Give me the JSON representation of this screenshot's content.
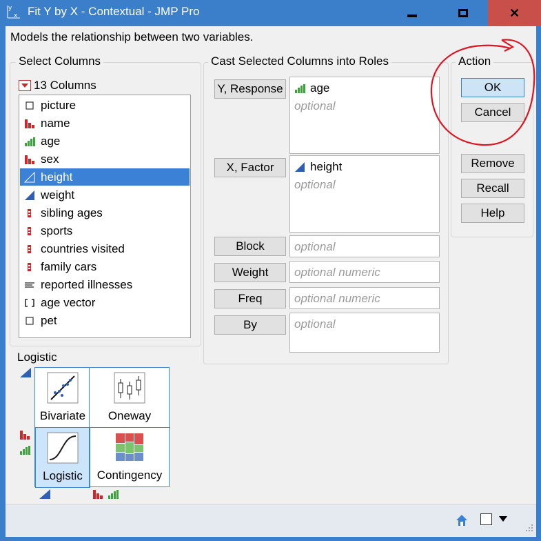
{
  "window": {
    "title": "Fit Y by X - Contextual - JMP Pro",
    "minimize": "minimize",
    "maximize": "maximize",
    "close": "close"
  },
  "description": "Models the relationship between two variables.",
  "select_columns": {
    "group_label": "Select Columns",
    "count_label": "13 Columns",
    "items": [
      {
        "label": "picture",
        "icon": "expression-icon"
      },
      {
        "label": "name",
        "icon": "nominal-icon"
      },
      {
        "label": "age",
        "icon": "ordinal-icon"
      },
      {
        "label": "sex",
        "icon": "nominal-icon"
      },
      {
        "label": "height",
        "icon": "continuous-icon",
        "selected": true
      },
      {
        "label": "weight",
        "icon": "continuous-icon"
      },
      {
        "label": "sibling ages",
        "icon": "multiple-response-icon"
      },
      {
        "label": "sports",
        "icon": "multiple-response-icon"
      },
      {
        "label": "countries visited",
        "icon": "multiple-response-icon"
      },
      {
        "label": "family cars",
        "icon": "multiple-response-icon"
      },
      {
        "label": "reported illnesses",
        "icon": "unstructured-text-icon"
      },
      {
        "label": "age vector",
        "icon": "vector-icon"
      },
      {
        "label": "pet",
        "icon": "expression-icon"
      }
    ]
  },
  "roles": {
    "group_label": "Cast Selected Columns into Roles",
    "y_response": {
      "button": "Y, Response",
      "value": "age",
      "placeholder": "optional"
    },
    "x_factor": {
      "button": "X, Factor",
      "value": "height",
      "placeholder": "optional"
    },
    "block": {
      "button": "Block",
      "placeholder": "optional"
    },
    "weight": {
      "button": "Weight",
      "placeholder": "optional numeric"
    },
    "freq": {
      "button": "Freq",
      "placeholder": "optional numeric"
    },
    "by": {
      "button": "By",
      "placeholder": "optional"
    }
  },
  "action": {
    "group_label": "Action",
    "ok": "OK",
    "cancel": "Cancel",
    "remove": "Remove",
    "recall": "Recall",
    "help": "Help"
  },
  "platform": {
    "label": "Logistic",
    "cells": {
      "bivariate": "Bivariate",
      "oneway": "Oneway",
      "logistic": "Logistic",
      "contingency": "Contingency"
    }
  },
  "colors": {
    "titlebar": "#3b7fcb",
    "close_button": "#c9504a",
    "selection": "#3b82d6",
    "nominal": "#d0262a",
    "ordinal": "#3aa33a",
    "continuous": "#2e5fb4",
    "annotation": "#e0141e"
  }
}
